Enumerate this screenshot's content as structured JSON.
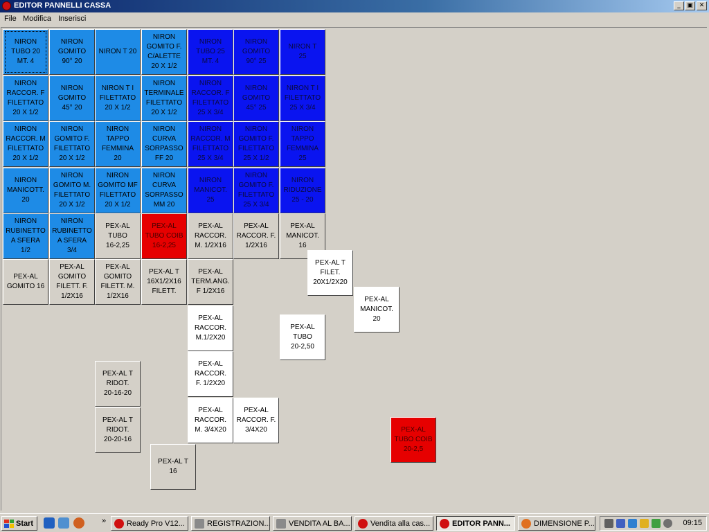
{
  "window": {
    "title": "EDITOR PANNELLI CASSA",
    "controls": {
      "minimize": "_",
      "maximize": "▣",
      "close": "✕"
    }
  },
  "menu": [
    "File",
    "Modifica",
    "Inserisci"
  ],
  "tiles": [
    {
      "label": "NIRON\nTUBO 20\nMT. 4",
      "color": "light-blue",
      "selected": true
    },
    {
      "label": "NIRON\nGOMITO\n90° 20",
      "color": "light-blue"
    },
    {
      "label": "NIRON T 20",
      "color": "light-blue"
    },
    {
      "label": "NIRON\nGOMITO F.\nC/ALETTE\n20 X 1/2",
      "color": "light-blue"
    },
    {
      "label": "NIRON\nTUBO 25\nMT. 4",
      "color": "dark-blue"
    },
    {
      "label": "NIRON\nGOMITO\n90° 25",
      "color": "dark-blue"
    },
    {
      "label": "NIRON T\n25",
      "color": "dark-blue"
    },
    {
      "label": "NIRON\nRACCOR. F\nFILETTATO\n20 X 1/2",
      "color": "light-blue"
    },
    {
      "label": "NIRON\nGOMITO\n45° 20",
      "color": "light-blue"
    },
    {
      "label": "NIRON T I\nFILETTATO\n20 X 1/2",
      "color": "light-blue"
    },
    {
      "label": "NIRON\nTERMINALE\nFILETTATO\n20 X 1/2",
      "color": "light-blue"
    },
    {
      "label": "NIRON\nRACCOR. F\nFILETTATO\n25 X 3/4",
      "color": "dark-blue"
    },
    {
      "label": "NIRON\nGOMITO\n45° 25",
      "color": "dark-blue"
    },
    {
      "label": "NIRON T I\nFILETTATO\n25 X 3/4",
      "color": "dark-blue"
    },
    {
      "label": "NIRON\nRACCOR. M\nFILETTATO\n20 X 1/2",
      "color": "light-blue"
    },
    {
      "label": "NIRON\nGOMITO F.\nFILETTATO\n20 X 1/2",
      "color": "light-blue"
    },
    {
      "label": "NIRON\nTAPPO\nFEMMINA\n20",
      "color": "light-blue"
    },
    {
      "label": "NIRON\nCURVA\nSORPASSO\nFF 20",
      "color": "light-blue"
    },
    {
      "label": "NIRON\nRACCOR. M\nFILETTATO\n25 X 3/4",
      "color": "dark-blue"
    },
    {
      "label": "NIRON\nGOMITO F.\nFILETTATO\n25 X 1/2",
      "color": "dark-blue"
    },
    {
      "label": "NIRON\nTAPPO\nFEMMINA\n25",
      "color": "dark-blue"
    },
    {
      "label": "NIRON\nMANICOTT.\n20",
      "color": "light-blue"
    },
    {
      "label": "NIRON\nGOMITO M.\nFILETTATO\n20 X 1/2",
      "color": "light-blue"
    },
    {
      "label": "NIRON\nGOMITO MF\nFILETTATO\n20 X 1/2",
      "color": "light-blue"
    },
    {
      "label": "NIRON\nCURVA\nSORPASSO\nMM 20",
      "color": "light-blue"
    },
    {
      "label": "NIRON\nMANICOT.\n25",
      "color": "dark-blue"
    },
    {
      "label": "NIRON\nGOMITO F.\nFILETTATO\n25 X 3/4",
      "color": "dark-blue"
    },
    {
      "label": "NIRON\nRIDUZIONE\n25 - 20",
      "color": "dark-blue"
    },
    {
      "label": "NIRON\nRUBINETTO\nA SFERA\n1/2",
      "color": "light-blue"
    },
    {
      "label": "NIRON\nRUBINETTO\nA SFERA\n3/4",
      "color": "light-blue"
    },
    {
      "label": "PEX-AL\nTUBO\n16-2,25",
      "color": "gray"
    },
    {
      "label": "PEX-AL\nTUBO COIB\n16-2,25",
      "color": "red"
    },
    {
      "label": "PEX-AL\nRACCOR.\nM. 1/2X16",
      "color": "gray"
    },
    {
      "label": "PEX-AL\nRACCOR. F.\n1/2X16",
      "color": "gray"
    },
    {
      "label": "PEX-AL\nMANICOT.\n16",
      "color": "gray"
    },
    {
      "label": "PEX-AL\nGOMITO 16",
      "color": "gray"
    },
    {
      "label": "PEX-AL\nGOMITO\nFILETT. F.\n1/2X16",
      "color": "gray"
    },
    {
      "label": "PEX-AL\nGOMITO\nFILETT. M.\n1/2X16",
      "color": "gray"
    },
    {
      "label": "PEX-AL T\n16X1/2X16\nFILETT.",
      "color": "gray"
    },
    {
      "label": "PEX-AL\nTERM.ANG.\nF 1/2X16",
      "color": "gray"
    },
    {
      "label": "PEX-AL T\nFILET.\n20X1/2X20",
      "color": "white"
    },
    {
      "label": "PEX-AL\nMANICOT.\n20",
      "color": "white"
    },
    {
      "label": "PEX-AL\nTUBO\n20-2,50",
      "color": "white"
    },
    {
      "label": "PEX-AL\nRACCOR.\nM.1/2X20",
      "color": "white"
    },
    {
      "label": "PEX-AL\nRACCOR.\nF. 1/2X20",
      "color": "white"
    },
    {
      "label": "PEX-AL\nRACCOR.\nM. 3/4X20",
      "color": "white"
    },
    {
      "label": "PEX-AL\nRACCOR. F.\n3/4X20",
      "color": "white"
    },
    {
      "label": "PEX-AL T\nRIDOT.\n20-16-20",
      "color": "gray"
    },
    {
      "label": "PEX-AL T\nRIDOT.\n20-20-16",
      "color": "gray"
    },
    {
      "label": "PEX-AL T\n16",
      "color": "gray"
    },
    {
      "label": "PEX-AL\nTUBO COIB\n20-2,5",
      "color": "red"
    }
  ],
  "taskbar": {
    "start_label": "Start",
    "overflow": "»",
    "tasks": [
      {
        "label": "Ready Pro V12...",
        "icon": "strawberry-icon",
        "active": false
      },
      {
        "label": "REGISTRAZION...",
        "icon": "printer-icon",
        "active": false
      },
      {
        "label": "VENDITA AL BA...",
        "icon": "printer-icon",
        "active": false
      },
      {
        "label": "Vendita alla cas...",
        "icon": "strawberry-icon",
        "active": false
      },
      {
        "label": "EDITOR PANN...",
        "icon": "strawberry-icon",
        "active": true
      },
      {
        "label": "DIMENSIONE P...",
        "icon": "firefox-icon",
        "active": false
      }
    ],
    "clock": "09:15"
  },
  "colors": {
    "light-blue": "#1e8be6",
    "dark-blue": "#0a14f0",
    "gray": "#d4d0c8",
    "white": "#ffffff",
    "red": "#e60000"
  }
}
